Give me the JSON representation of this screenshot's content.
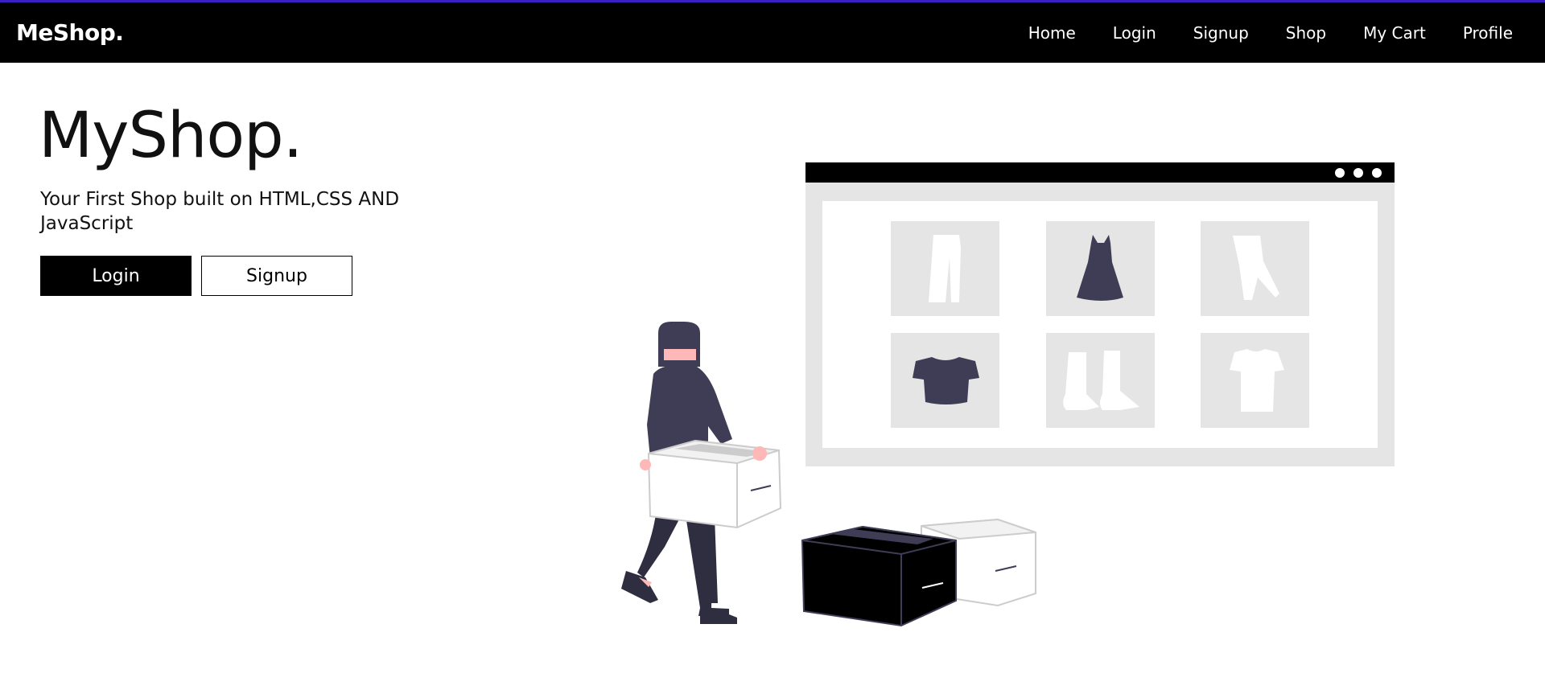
{
  "navbar": {
    "brand": "MeShop.",
    "links": [
      "Home",
      "Login",
      "Signup",
      "Shop",
      "My Cart",
      "Profile"
    ],
    "accent_color": "#3b1fc4"
  },
  "hero": {
    "title": "MyShop.",
    "subtitle": "Your First Shop built on HTML,CSS AND JavaScript",
    "login_label": "Login",
    "signup_label": "Signup"
  },
  "illustration": {
    "icons": [
      "pants-icon",
      "dress-icon",
      "leggings-icon",
      "shirt-icon",
      "boots-icon",
      "tshirt-icon"
    ]
  }
}
